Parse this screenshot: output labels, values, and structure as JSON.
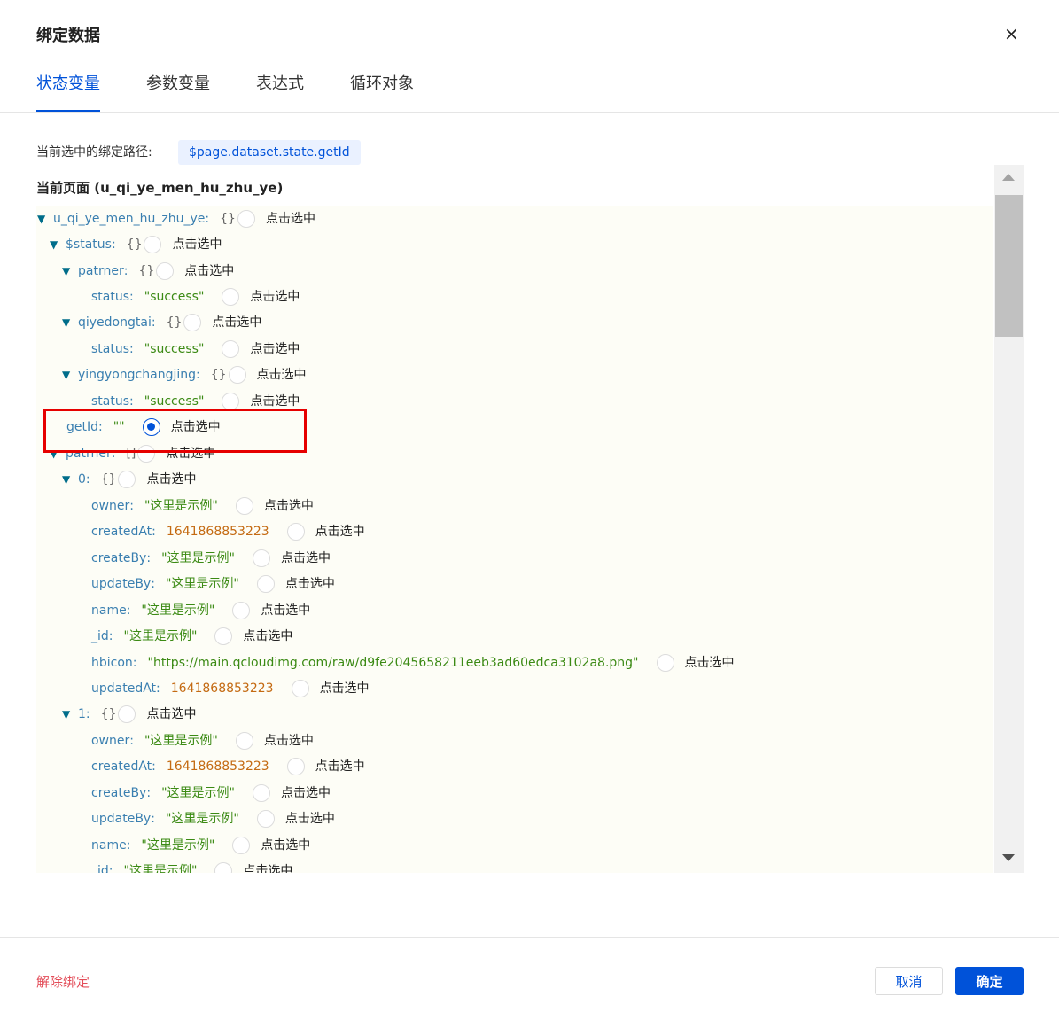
{
  "dialog": {
    "title": "绑定数据",
    "close_icon": "×"
  },
  "tabs": [
    {
      "label": "状态变量",
      "active": true
    },
    {
      "label": "参数变量"
    },
    {
      "label": "表达式"
    },
    {
      "label": "循环对象"
    }
  ],
  "binding_path": {
    "label": "当前选中的绑定路径:",
    "value": "$page.dataset.state.getId"
  },
  "section_title": "当前页面 (u_qi_ye_men_hu_zhu_ye)",
  "tree": {
    "select_label": "点击选中",
    "rows": [
      {
        "key": "u_qi_ye_men_hu_zhu_ye",
        "expanded": true,
        "brace": "{}",
        "value": "",
        "vtype": ""
      },
      {
        "key": "$status",
        "expanded": true,
        "brace": "{}",
        "value": "",
        "vtype": ""
      },
      {
        "key": "patrner",
        "expanded": true,
        "brace": "{}",
        "value": "",
        "vtype": ""
      },
      {
        "key": "status",
        "expanded": false,
        "brace": "",
        "value": "\"success\"",
        "vtype": "str"
      },
      {
        "key": "qiyedongtai",
        "expanded": true,
        "brace": "{}",
        "value": "",
        "vtype": ""
      },
      {
        "key": "status",
        "expanded": false,
        "brace": "",
        "value": "\"success\"",
        "vtype": "str"
      },
      {
        "key": "yingyongchangjing",
        "expanded": true,
        "brace": "{}",
        "value": "",
        "vtype": ""
      },
      {
        "key": "status",
        "expanded": false,
        "brace": "",
        "value": "\"success\"",
        "vtype": "str"
      },
      {
        "key": "getId",
        "expanded": false,
        "brace": "",
        "value": "\"\"",
        "vtype": "str",
        "selected": true
      },
      {
        "key": "patrner",
        "expanded": true,
        "brace": "[]",
        "value": "",
        "vtype": ""
      },
      {
        "key": "0",
        "expanded": true,
        "brace": "{}",
        "value": "",
        "vtype": ""
      },
      {
        "key": "owner",
        "expanded": false,
        "brace": "",
        "value": "\"这里是示例\"",
        "vtype": "str"
      },
      {
        "key": "createdAt",
        "expanded": false,
        "brace": "",
        "value": "1641868853223",
        "vtype": "num"
      },
      {
        "key": "createBy",
        "expanded": false,
        "brace": "",
        "value": "\"这里是示例\"",
        "vtype": "str"
      },
      {
        "key": "updateBy",
        "expanded": false,
        "brace": "",
        "value": "\"这里是示例\"",
        "vtype": "str"
      },
      {
        "key": "name",
        "expanded": false,
        "brace": "",
        "value": "\"这里是示例\"",
        "vtype": "str"
      },
      {
        "key": "_id",
        "expanded": false,
        "brace": "",
        "value": "\"这里是示例\"",
        "vtype": "str"
      },
      {
        "key": "hbicon",
        "expanded": false,
        "brace": "",
        "value": "\"https://main.qcloudimg.com/raw/d9fe2045658211eeb3ad60edca3102a8.png\"",
        "vtype": "str"
      },
      {
        "key": "updatedAt",
        "expanded": false,
        "brace": "",
        "value": "1641868853223",
        "vtype": "num"
      },
      {
        "key": "1",
        "expanded": true,
        "brace": "{}",
        "value": "",
        "vtype": ""
      },
      {
        "key": "owner",
        "expanded": false,
        "brace": "",
        "value": "\"这里是示例\"",
        "vtype": "str"
      },
      {
        "key": "createdAt",
        "expanded": false,
        "brace": "",
        "value": "1641868853223",
        "vtype": "num"
      },
      {
        "key": "createBy",
        "expanded": false,
        "brace": "",
        "value": "\"这里是示例\"",
        "vtype": "str"
      },
      {
        "key": "updateBy",
        "expanded": false,
        "brace": "",
        "value": "\"这里是示例\"",
        "vtype": "str"
      },
      {
        "key": "name",
        "expanded": false,
        "brace": "",
        "value": "\"这里是示例\"",
        "vtype": "str"
      },
      {
        "key": "_id",
        "expanded": false,
        "brace": "",
        "value": "\"这里是示例\"",
        "vtype": "str"
      }
    ]
  },
  "footer": {
    "unbind_label": "解除绑定",
    "cancel_label": "取消",
    "ok_label": "确定"
  },
  "colors": {
    "primary": "#0052d9",
    "danger": "#e34d59",
    "string": "#3b8a14",
    "number": "#c46a12",
    "key": "#3a7fb0",
    "highlight_border": "#e60000"
  }
}
